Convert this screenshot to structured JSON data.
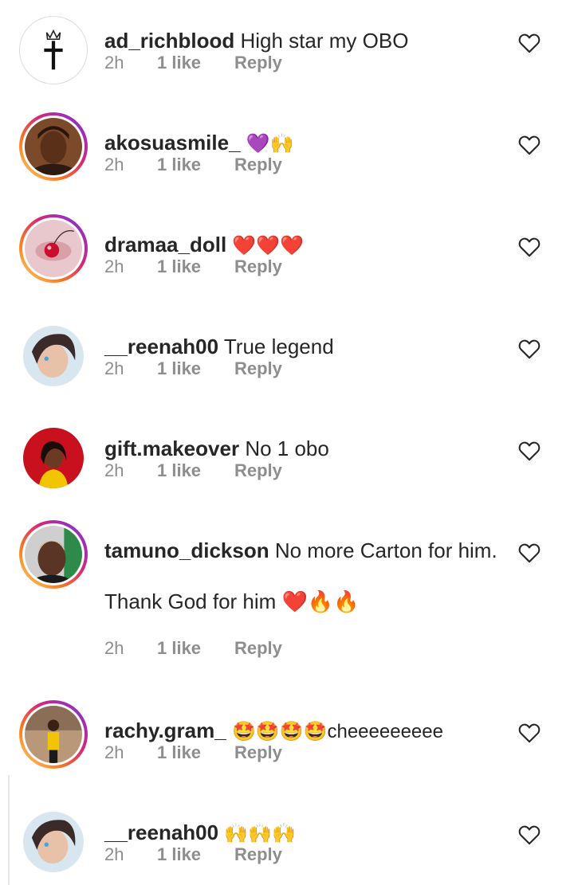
{
  "colors": {
    "text": "#262626",
    "meta": "#8e8e8e",
    "heart": "#262626",
    "red": "#e0102a"
  },
  "comments": [
    {
      "username": "ad_richblood",
      "text": "High star my OBO",
      "time": "2h",
      "likes": "1 like",
      "reply": "Reply",
      "icon": "heart-outline-icon"
    },
    {
      "username": "akosuasmile_",
      "text": "💜🙌",
      "time": "2h",
      "likes": "1 like",
      "reply": "Reply",
      "icon": "heart-outline-icon"
    },
    {
      "username": "dramaa_doll",
      "text": "❤️❤️❤️",
      "time": "2h",
      "likes": "1 like",
      "reply": "Reply",
      "icon": "heart-outline-icon"
    },
    {
      "username": "__reenah00",
      "text": "True legend",
      "time": "2h",
      "likes": "1 like",
      "reply": "Reply",
      "icon": "heart-outline-icon"
    },
    {
      "username": "gift.makeover",
      "text": "No 1 obo",
      "time": "2h",
      "likes": "1 like",
      "reply": "Reply",
      "icon": "heart-outline-icon"
    },
    {
      "username": "tamuno_dickson",
      "text": "No more Carton for him.",
      "text2": "Thank God for him ❤️🔥🔥",
      "time": "2h",
      "likes": "1 like",
      "reply": "Reply",
      "icon": "heart-outline-icon"
    },
    {
      "username": "rachy.gram_",
      "text": "🤩🤩🤩🤩cheeeeeeeee",
      "time": "2h",
      "likes": "1 like",
      "reply": "Reply",
      "icon": "heart-outline-icon"
    },
    {
      "username": "__reenah00",
      "text": "🙌🙌🙌",
      "time": "2h",
      "likes": "1 like",
      "reply": "Reply",
      "icon": "heart-outline-icon"
    }
  ]
}
